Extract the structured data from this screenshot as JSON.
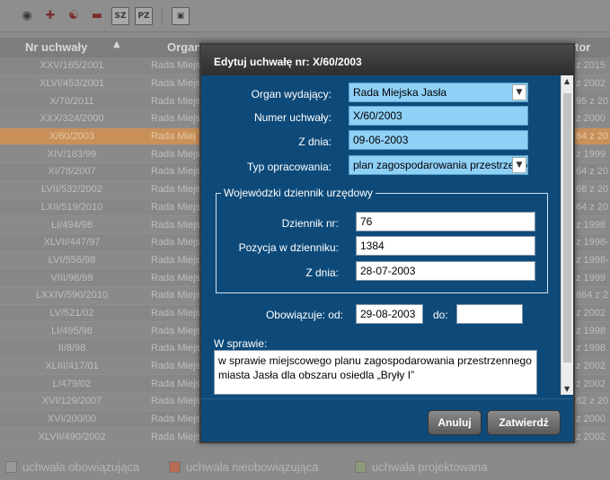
{
  "toolbar": {
    "icons": [
      "binoculars-icon",
      "add-icon",
      "add-user-icon",
      "remove-icon",
      "sz-icon",
      "pz-icon",
      "print-icon"
    ],
    "sz_label": "SZ",
    "pz_label": "PZ"
  },
  "table": {
    "headers": {
      "nr": "Nr uchwały",
      "organ": "Organ",
      "autor": "tor"
    },
    "rows": [
      {
        "nr": "XXV/165/2001",
        "organ": "Rada Miejsk",
        "extra": "z 2015"
      },
      {
        "nr": "XLVI/453/2001",
        "organ": "Rada Miejsk",
        "extra": "z 2002"
      },
      {
        "nr": "X/70/2011",
        "organ": "Rada Miejsk",
        "extra": "95 z 20"
      },
      {
        "nr": "XXX/324/2000",
        "organ": "Rada Miejsk",
        "extra": "z 2000"
      },
      {
        "nr": "X/60/2003",
        "organ": "Rada Miej",
        "extra": "84 z 20",
        "selected": true
      },
      {
        "nr": "XIV/183/99",
        "organ": "Rada Miejsk",
        "extra": "z 1999"
      },
      {
        "nr": "XI/78/2007",
        "organ": "Rada Miejsk",
        "extra": "64 z 20"
      },
      {
        "nr": "LVII/532/2002",
        "organ": "Rada Miejsk",
        "extra": "68 z 20"
      },
      {
        "nr": "LXII/519/2010",
        "organ": "Rada Miejsk",
        "extra": "64 z 20"
      },
      {
        "nr": "LI/494/98",
        "organ": "Rada Miejsk",
        "extra": "z 1998"
      },
      {
        "nr": "XLVII/447/97",
        "organ": "Rada Miejsk",
        "extra": "z 1998-"
      },
      {
        "nr": "LVI/556/98",
        "organ": "Rada Miejsk",
        "extra": "z 1998-"
      },
      {
        "nr": "VIII/96/99",
        "organ": "Rada Miejsk",
        "extra": "z 1999"
      },
      {
        "nr": "LXXIV/590/2010",
        "organ": "Rada Miejsk",
        "extra": "864 z 2"
      },
      {
        "nr": "LV/521/02",
        "organ": "Rada Miejsk",
        "extra": "z 2002"
      },
      {
        "nr": "LI/495/98",
        "organ": "Rada Miejsk",
        "extra": "z 1998"
      },
      {
        "nr": "II/8/98",
        "organ": "Rada Miejsk",
        "extra": "z 1998"
      },
      {
        "nr": "XLIII/417/01",
        "organ": "Rada Miejsk",
        "extra": "z 2002"
      },
      {
        "nr": "L/479/02",
        "organ": "Rada Miejsk",
        "extra": "z 2002"
      },
      {
        "nr": "XVI/129/2007",
        "organ": "Rada Miejsk",
        "extra": "82 z 20"
      },
      {
        "nr": "XVI/200/00",
        "organ": "Rada Miejsk",
        "extra": "z 2000"
      },
      {
        "nr": "XLVII/490/2002",
        "organ": "Rada Miejsk",
        "extra": "z 2002"
      }
    ]
  },
  "legend": {
    "items": [
      {
        "label": "uchwała obowiązująca",
        "color": "#9a9a9a"
      },
      {
        "label": "uchwała nieobowiązująca",
        "color": "#b56b55"
      },
      {
        "label": "uchwała projektowana",
        "color": "#8b9a7a"
      }
    ]
  },
  "modal": {
    "title": "Edytuj uchwałę nr: X/60/2003",
    "organ_label": "Organ wydający:",
    "organ_value": "Rada Miejska Jasła",
    "numer_label": "Numer uchwały:",
    "numer_value": "X/60/2003",
    "z_dnia_label": "Z dnia:",
    "z_dnia_value": "09-06-2003",
    "typ_label": "Typ opracowania:",
    "typ_value": "plan zagospodarowania przestrzennego",
    "dziennik_legend": "Wojewódzki dziennik urzędowy",
    "dziennik_nr_label": "Dziennik nr:",
    "dziennik_nr_value": "76",
    "pozycja_label": "Pozycja w dzienniku:",
    "pozycja_value": "1384",
    "dz_z_dnia_label": "Z dnia:",
    "dz_z_dnia_value": "28-07-2003",
    "obowiazuje_label": "Obowiązuje: od:",
    "obowiazuje_od_value": "29-08-2003",
    "do_label": "do:",
    "do_value": "",
    "w_sprawie_label": "W sprawie:",
    "w_sprawie_value": "w sprawie miejscowego planu zagospodarowania przestrzennego miasta Jasła dla obszaru osiedla „Bryły I”",
    "cancel_label": "Anuluj",
    "confirm_label": "Zatwierdź"
  }
}
